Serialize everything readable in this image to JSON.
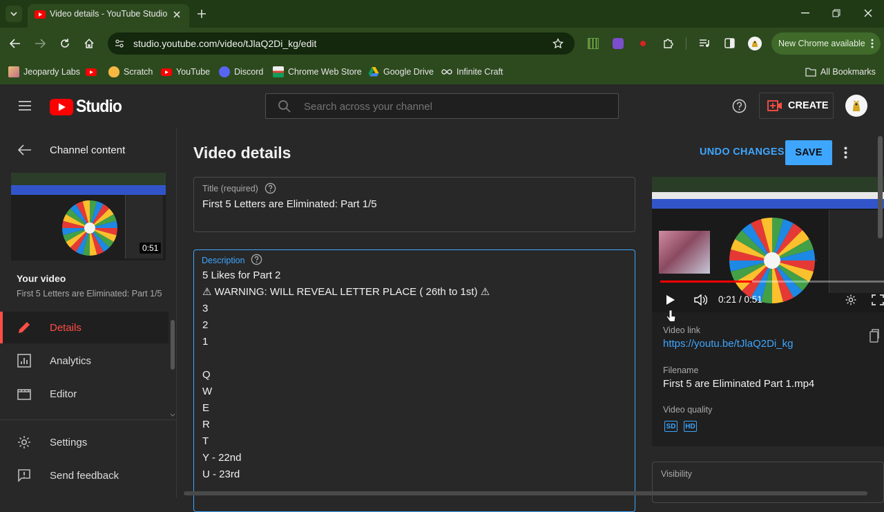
{
  "browser": {
    "tab_title": "Video details - YouTube Studio",
    "url": "studio.youtube.com/video/tJlaQ2Di_kg/edit",
    "new_chrome_label": "New Chrome available",
    "bookmarks": [
      "Jeopardy Labs",
      "Scratch",
      "YouTube",
      "Discord",
      "Chrome Web Store",
      "Google Drive",
      "Infinite Craft"
    ],
    "all_bookmarks": "All Bookmarks"
  },
  "studio": {
    "logo_text": "Studio",
    "search_placeholder": "Search across your channel",
    "create_label": "CREATE"
  },
  "sidebar": {
    "back_label": "Channel content",
    "thumb_duration": "0:51",
    "your_video_label": "Your video",
    "video_title": "First 5 Letters are Eliminated: Part 1/5",
    "items": [
      {
        "label": "Details",
        "active": true
      },
      {
        "label": "Analytics",
        "active": false
      },
      {
        "label": "Editor",
        "active": false
      }
    ],
    "settings_label": "Settings",
    "feedback_label": "Send feedback"
  },
  "main": {
    "page_title": "Video details",
    "undo_label": "UNDO CHANGES",
    "save_label": "SAVE",
    "title_label": "Title (required)",
    "title_value": "First 5 Letters are Eliminated: Part 1/5",
    "description_label": "Description",
    "description_lines": [
      "5 Likes for Part 2",
      "⚠ WARNING: WILL REVEAL LETTER PLACE ( 26th to 1st) ⚠",
      "3",
      "2",
      "1",
      "",
      "Q",
      "W",
      "E",
      "R",
      "T",
      "Y - 22nd",
      "U - 23rd"
    ]
  },
  "preview": {
    "time": "0:21 / 0:51",
    "progress": 0.41,
    "video_link_label": "Video link",
    "video_link": "https://youtu.be/tJlaQ2Di_kg",
    "filename_label": "Filename",
    "filename": "First 5 are Eliminated Part 1.mp4",
    "quality_label": "Video quality",
    "quality_badges": [
      "SD",
      "HD"
    ],
    "visibility_label": "Visibility"
  },
  "colors": {
    "accent_blue": "#3ea6ff",
    "active_red": "#ff4e45",
    "youtube_red": "#ff0000",
    "chrome_green": "#2d4a1f"
  }
}
